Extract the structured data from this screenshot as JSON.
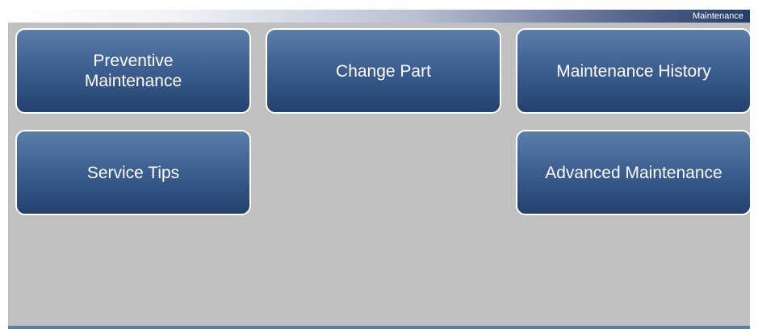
{
  "header": {
    "title": "Maintenance"
  },
  "buttons": {
    "preventive_maintenance": "Preventive\nMaintenance",
    "change_part": "Change Part",
    "maintenance_history": "Maintenance History",
    "service_tips": "Service Tips",
    "advanced_maintenance": "Advanced Maintenance"
  },
  "colors": {
    "screen_background": "#c0c0c0",
    "button_top": "#5a7eaa",
    "button_bottom": "#23416e",
    "button_border": "#ffffff"
  }
}
